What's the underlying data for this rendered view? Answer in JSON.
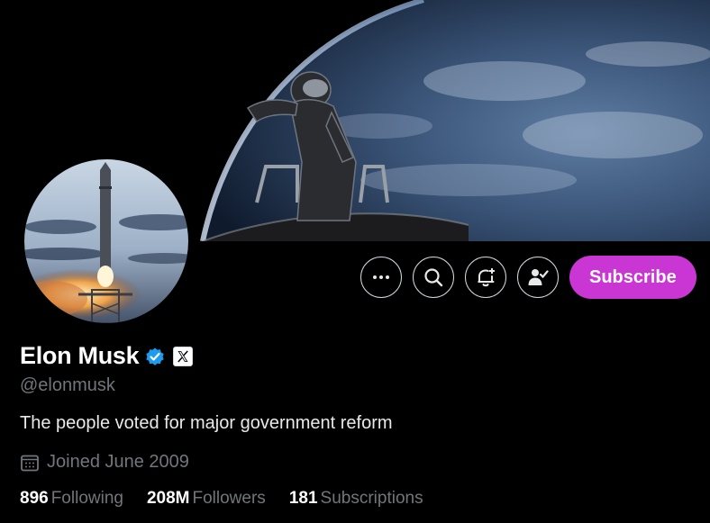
{
  "banner": {
    "description_icon": "astronaut-earth-banner"
  },
  "avatar": {
    "description_icon": "starship-launch-avatar"
  },
  "actions": {
    "more_icon": "more-icon",
    "search_icon": "search-icon",
    "notify_icon": "bell-plus-icon",
    "following_icon": "user-check-icon",
    "subscribe_label": "Subscribe",
    "subscribe_color": "#c936d4"
  },
  "profile": {
    "name": "Elon Musk",
    "handle": "@elonmusk",
    "bio": "The people voted for major government reform",
    "joined": "Joined June 2009",
    "verified_color": "#1d9bf0"
  },
  "stats": [
    {
      "count": "896",
      "label": "Following"
    },
    {
      "count": "208M",
      "label": "Followers"
    },
    {
      "count": "181",
      "label": "Subscriptions"
    }
  ]
}
